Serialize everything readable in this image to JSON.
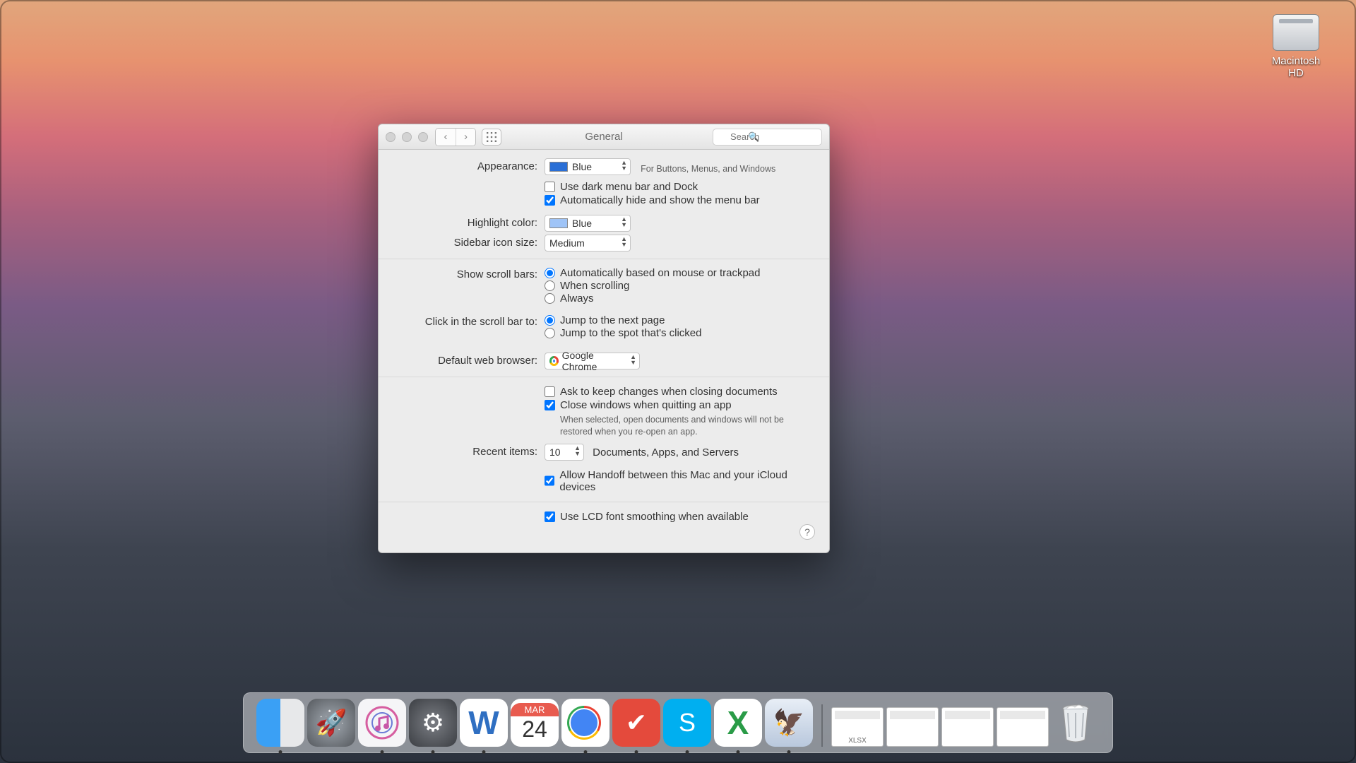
{
  "desktop": {
    "drive_label": "Macintosh HD"
  },
  "window": {
    "title": "General",
    "search_placeholder": "Search",
    "appearance": {
      "label": "Appearance:",
      "value": "Blue",
      "hint": "For Buttons, Menus, and Windows",
      "dark_menubar": {
        "checked": false,
        "label": "Use dark menu bar and Dock"
      },
      "auto_hide_menubar": {
        "checked": true,
        "label": "Automatically hide and show the menu bar"
      }
    },
    "highlight": {
      "label": "Highlight color:",
      "value": "Blue"
    },
    "sidebar": {
      "label": "Sidebar icon size:",
      "value": "Medium"
    },
    "scrollbars": {
      "label": "Show scroll bars:",
      "options": [
        "Automatically based on mouse or trackpad",
        "When scrolling",
        "Always"
      ],
      "selected": 0
    },
    "click_scroll": {
      "label": "Click in the scroll bar to:",
      "options": [
        "Jump to the next page",
        "Jump to the spot that's clicked"
      ],
      "selected": 0
    },
    "browser": {
      "label": "Default web browser:",
      "value": "Google Chrome"
    },
    "documents": {
      "ask_keep": {
        "checked": false,
        "label": "Ask to keep changes when closing documents"
      },
      "close_windows": {
        "checked": true,
        "label": "Close windows when quitting an app"
      },
      "close_hint": "When selected, open documents and windows will not be restored when you re-open an app."
    },
    "recent": {
      "label": "Recent items:",
      "value": "10",
      "suffix": "Documents, Apps, and Servers"
    },
    "handoff": {
      "checked": true,
      "label": "Allow Handoff between this Mac and your iCloud devices"
    },
    "lcd": {
      "checked": true,
      "label": "Use LCD font smoothing when available"
    }
  },
  "dock": {
    "apps": [
      "Finder",
      "Launchpad",
      "iTunes",
      "System Preferences",
      "Microsoft Word",
      "Calendar",
      "Google Chrome",
      "Todoist",
      "Skype",
      "Microsoft Excel",
      "Mail"
    ],
    "cal_month": "MAR",
    "cal_day": "24",
    "mini_labels": [
      "XLSX",
      "",
      "",
      ""
    ]
  }
}
